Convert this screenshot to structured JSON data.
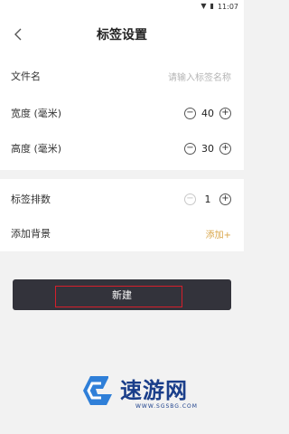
{
  "status_bar": {
    "time": "11:07"
  },
  "header": {
    "title": "标签设置"
  },
  "form": {
    "filename": {
      "label": "文件名",
      "placeholder": "请输入标签名称"
    },
    "width": {
      "label": "宽度 (毫米)",
      "value": "40"
    },
    "height": {
      "label": "高度 (毫米)",
      "value": "30"
    },
    "rows": {
      "label": "标签排数",
      "value": "1"
    },
    "background": {
      "label": "添加背景",
      "action": "添加+"
    }
  },
  "actions": {
    "create_label": "新建"
  },
  "watermark": {
    "text": "速游网",
    "url": "WWW.SGSBG.COM"
  },
  "colors": {
    "accent": "#d9a64a",
    "button_bg": "#33333b",
    "highlight": "#d61f2b"
  }
}
